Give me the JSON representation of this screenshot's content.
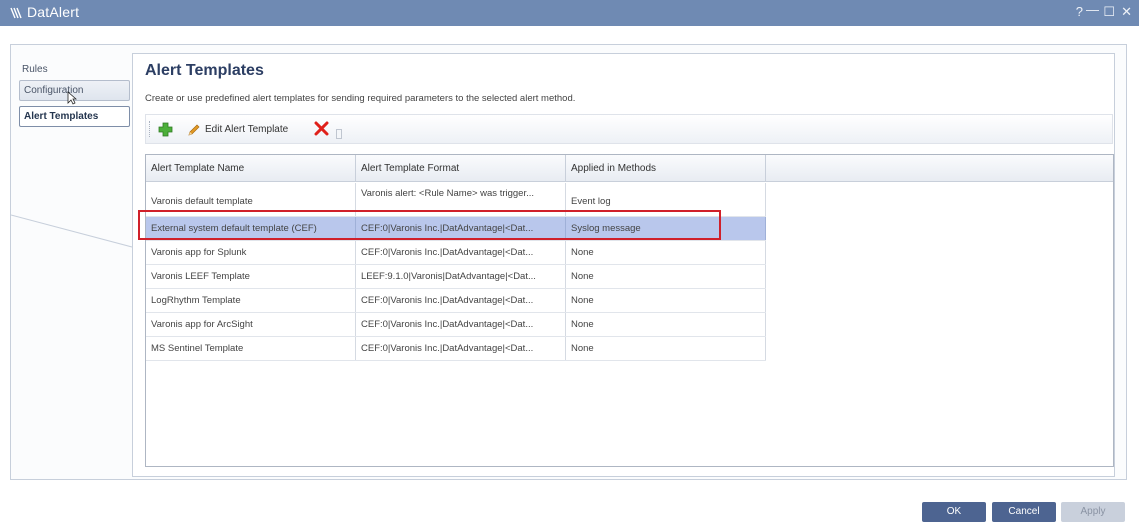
{
  "window": {
    "title": "DatAlert",
    "controls": {
      "help": "?",
      "minimize": "—",
      "maximize": "☐",
      "close": "✕"
    }
  },
  "nav": {
    "items": [
      {
        "label": "Rules"
      },
      {
        "label": "Configuration"
      },
      {
        "label": "Alert Templates"
      }
    ]
  },
  "page": {
    "title": "Alert Templates",
    "description": "Create or use predefined alert templates for sending required parameters to the selected alert method."
  },
  "toolbar": {
    "edit_label": "Edit Alert Template"
  },
  "grid": {
    "columns": [
      "Alert Template Name",
      "Alert Template Format",
      "Applied in Methods"
    ],
    "rows": [
      {
        "name": "Varonis default template",
        "format": "Varonis alert: <Rule Name> was trigger...",
        "methods": "Event log"
      },
      {
        "name": "External system default template (CEF)",
        "format": "CEF:0|Varonis Inc.|DatAdvantage|<Dat...",
        "methods": "Syslog message"
      },
      {
        "name": "Varonis app for Splunk",
        "format": "CEF:0|Varonis Inc.|DatAdvantage|<Dat...",
        "methods": "None"
      },
      {
        "name": "Varonis LEEF Template",
        "format": "LEEF:9.1.0|Varonis|DatAdvantage|<Dat...",
        "methods": "None"
      },
      {
        "name": "LogRhythm Template",
        "format": "CEF:0|Varonis Inc.|DatAdvantage|<Dat...",
        "methods": "None"
      },
      {
        "name": "Varonis app for ArcSight",
        "format": "CEF:0|Varonis Inc.|DatAdvantage|<Dat...",
        "methods": "None"
      },
      {
        "name": "MS Sentinel Template",
        "format": "CEF:0|Varonis Inc.|DatAdvantage|<Dat...",
        "methods": "None"
      }
    ]
  },
  "footer": {
    "ok": "OK",
    "cancel": "Cancel",
    "apply": "Apply"
  },
  "colors": {
    "titlebar": "#6f8ab3",
    "selection": "#b9c7ec",
    "highlight_box": "#d0202a",
    "primary_button": "#4d6491"
  }
}
